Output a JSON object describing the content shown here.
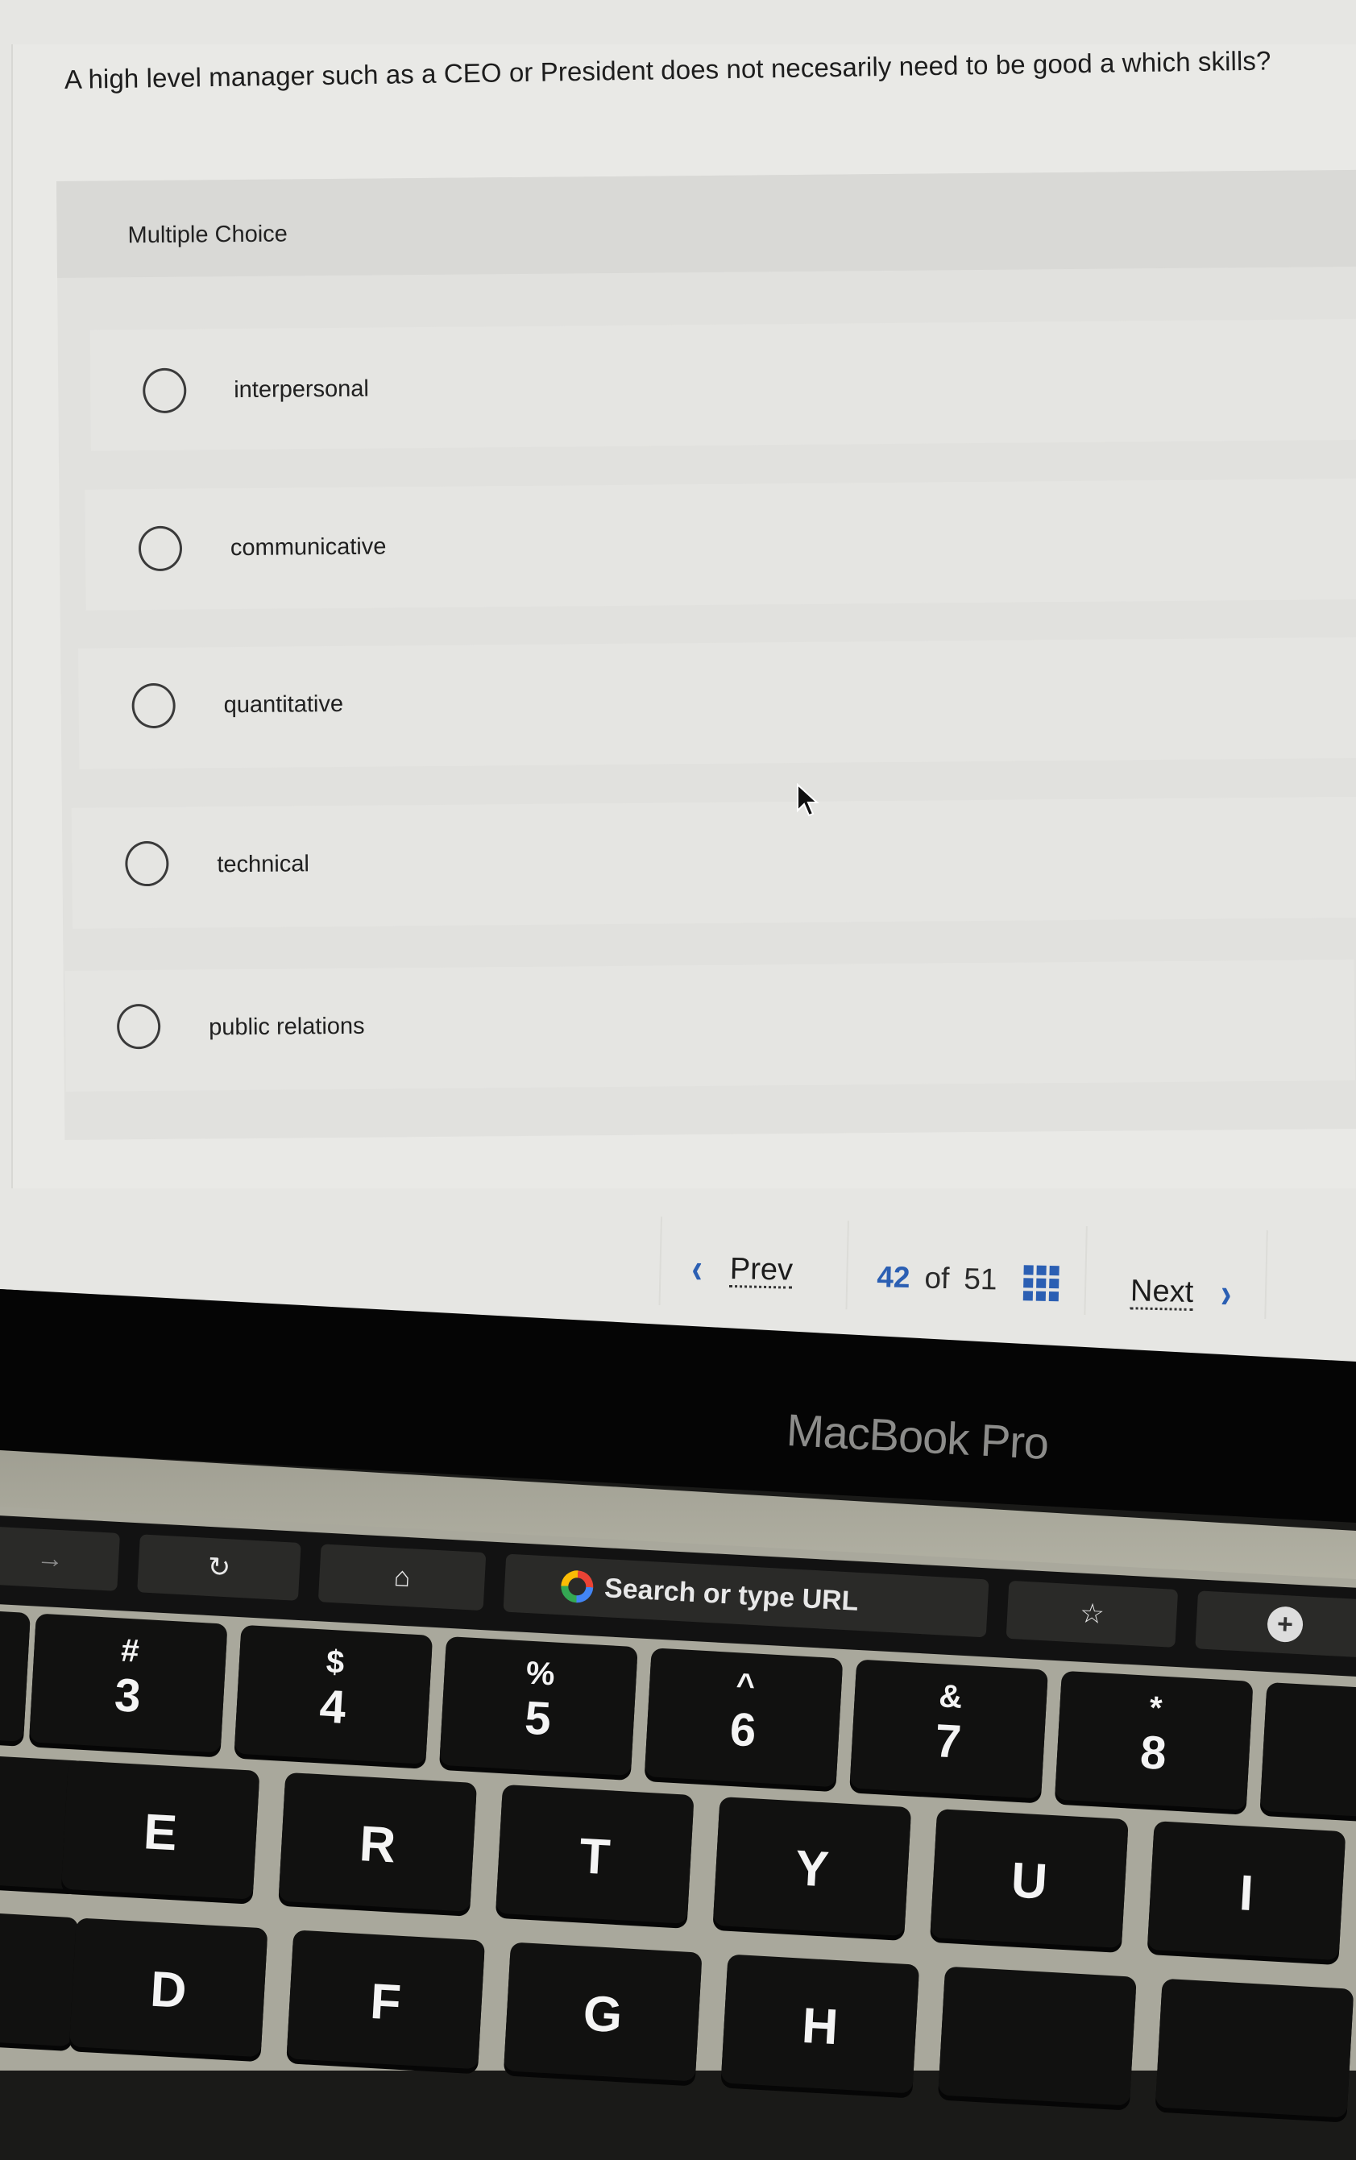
{
  "question": {
    "text": "A high level manager such as a CEO or President does not necesarily need to be good a which skills?",
    "type_label": "Multiple Choice",
    "options": [
      {
        "label": "interpersonal",
        "selected": false
      },
      {
        "label": "communicative",
        "selected": false
      },
      {
        "label": "quantitative",
        "selected": false
      },
      {
        "label": "technical",
        "selected": false
      },
      {
        "label": "public relations",
        "selected": false
      }
    ]
  },
  "navigation": {
    "prev_label": "Prev",
    "next_label": "Next",
    "current_page": "42",
    "of_label": "of",
    "total_pages": "51",
    "prev_icon": "chevron-left-icon",
    "next_icon": "chevron-right-icon",
    "grid_icon": "question-grid-icon",
    "accent_color": "#2b5fb3"
  },
  "device": {
    "brand_label": "MacBook Pro"
  },
  "touch_bar": {
    "forward_icon": "→",
    "reload_icon": "↻",
    "home_icon": "⌂",
    "search_placeholder": "Search or type URL",
    "bookmark_icon": "☆",
    "new_tab_icon": "+"
  },
  "keyboard": {
    "number_row": [
      {
        "sym": "#",
        "main": "3"
      },
      {
        "sym": "$",
        "main": "4"
      },
      {
        "sym": "%",
        "main": "5"
      },
      {
        "sym": "^",
        "main": "6"
      },
      {
        "sym": "&",
        "main": "7"
      },
      {
        "sym": "*",
        "main": "8"
      }
    ],
    "top_row": [
      "E",
      "R",
      "T",
      "Y",
      "U",
      "I"
    ],
    "home_row": [
      "D",
      "F",
      "G",
      "H"
    ]
  }
}
